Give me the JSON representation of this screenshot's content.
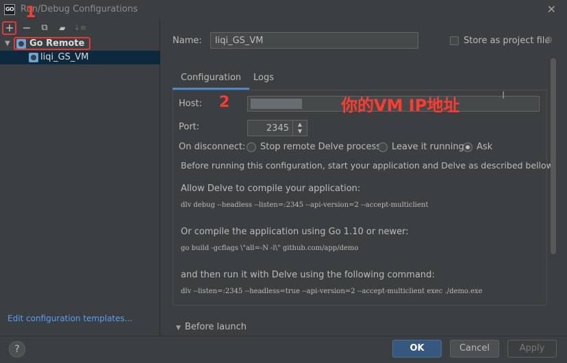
{
  "window": {
    "title": "Run/Debug Configurations",
    "app_icon": "GO"
  },
  "toolbar": {
    "add": "+",
    "remove": "−",
    "copy": "⧉",
    "folder": "▰",
    "sort": "↓≡"
  },
  "annotations": {
    "one": "1",
    "two": "2",
    "vm_ip": "你的VM IP地址"
  },
  "tree": {
    "group": "Go Remote",
    "item": "liqi_GS_VM"
  },
  "edit_templates": "Edit configuration templates...",
  "name_label": "Name:",
  "name_value": "liqi_GS_VM",
  "store_label": "Store as project file",
  "tabs": [
    "Configuration",
    "Logs"
  ],
  "host_label": "Host:",
  "port_label": "Port:",
  "port_value": "2345",
  "disconnect_label": "On disconnect:",
  "disconnect_options": [
    "Stop remote Delve process",
    "Leave it running",
    "Ask"
  ],
  "desc": {
    "intro": "Before running this configuration, start your application and Delve as described bellow.",
    "allow": "Allow Delve to compile your application:",
    "cmd1": "dlv debug --headless --listen=:2345 --api-version=2 --accept-multiclient",
    "or": "Or compile the application using Go 1.10 or newer:",
    "cmd2": "go build -gcflags \\\"all=-N -l\\\" github.com/app/demo",
    "then": "and then run it with Delve using the following command:",
    "cmd3": "dlv --listen=:2345 --headless=true --api-version=2 --accept-multiclient exec ./demo.exe"
  },
  "before_launch": "Before launch",
  "buttons": {
    "help": "?",
    "ok": "OK",
    "cancel": "Cancel",
    "apply": "Apply"
  },
  "colors": {
    "annotation": "#e53935",
    "accent": "#4a88c7",
    "selection": "#0d293e"
  }
}
